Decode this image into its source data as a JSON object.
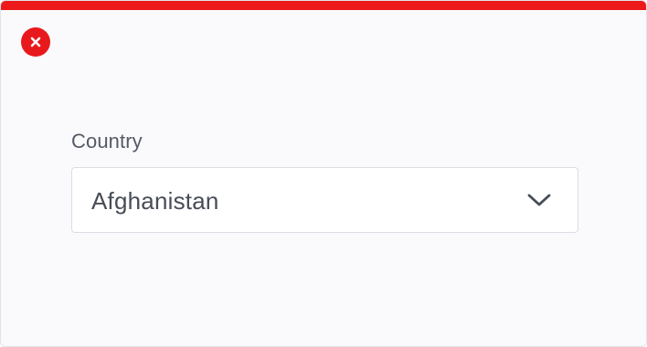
{
  "form": {
    "country_label": "Country",
    "country_value": "Afghanistan"
  },
  "icons": {
    "error": "close-circle-icon",
    "dropdown": "chevron-down-icon"
  },
  "colors": {
    "error_accent": "#ec1a1a",
    "card_background": "#fafafc",
    "text": "#474c57"
  }
}
